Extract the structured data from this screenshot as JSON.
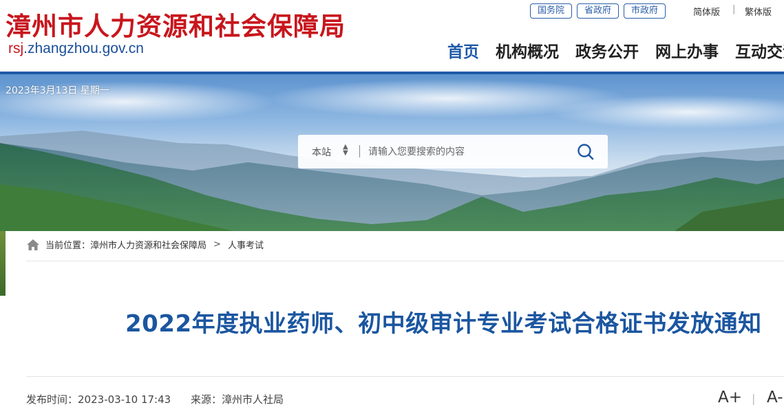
{
  "header": {
    "site_title": "漳州市人力资源和社会保障局",
    "domain_prefix": "rsj",
    "domain_rest": ".zhangzhou.gov.cn",
    "gov_links": [
      "国务院",
      "省政府",
      "市政府"
    ],
    "lang": {
      "simplified": "简体版",
      "separator": "|",
      "traditional": "繁体版"
    },
    "nav": [
      {
        "label": "首页",
        "active": true
      },
      {
        "label": "机构概况"
      },
      {
        "label": "政务公开"
      },
      {
        "label": "网上办事"
      },
      {
        "label": "互动交流"
      }
    ]
  },
  "banner": {
    "date": "2023年3月13日 星期一",
    "search": {
      "scope": "本站",
      "placeholder": "请输入您要搜索的内容",
      "icon": "search-icon"
    }
  },
  "breadcrumb": {
    "prefix": "当前位置：",
    "items": [
      "漳州市人力资源和社会保障局",
      "人事考试"
    ],
    "separator": ">"
  },
  "article": {
    "title": "2022年度执业药师、初中级审计专业考试合格证书发放通知",
    "publish_label": "发布时间：",
    "publish_time": "2023-03-10 17:43",
    "source_label": "来源：",
    "source": "漳州市人社局",
    "font_increase": "A+",
    "font_separator": "|",
    "font_decrease": "A-"
  },
  "colors": {
    "brand_red": "#c8161d",
    "brand_blue": "#1f5aa6"
  }
}
